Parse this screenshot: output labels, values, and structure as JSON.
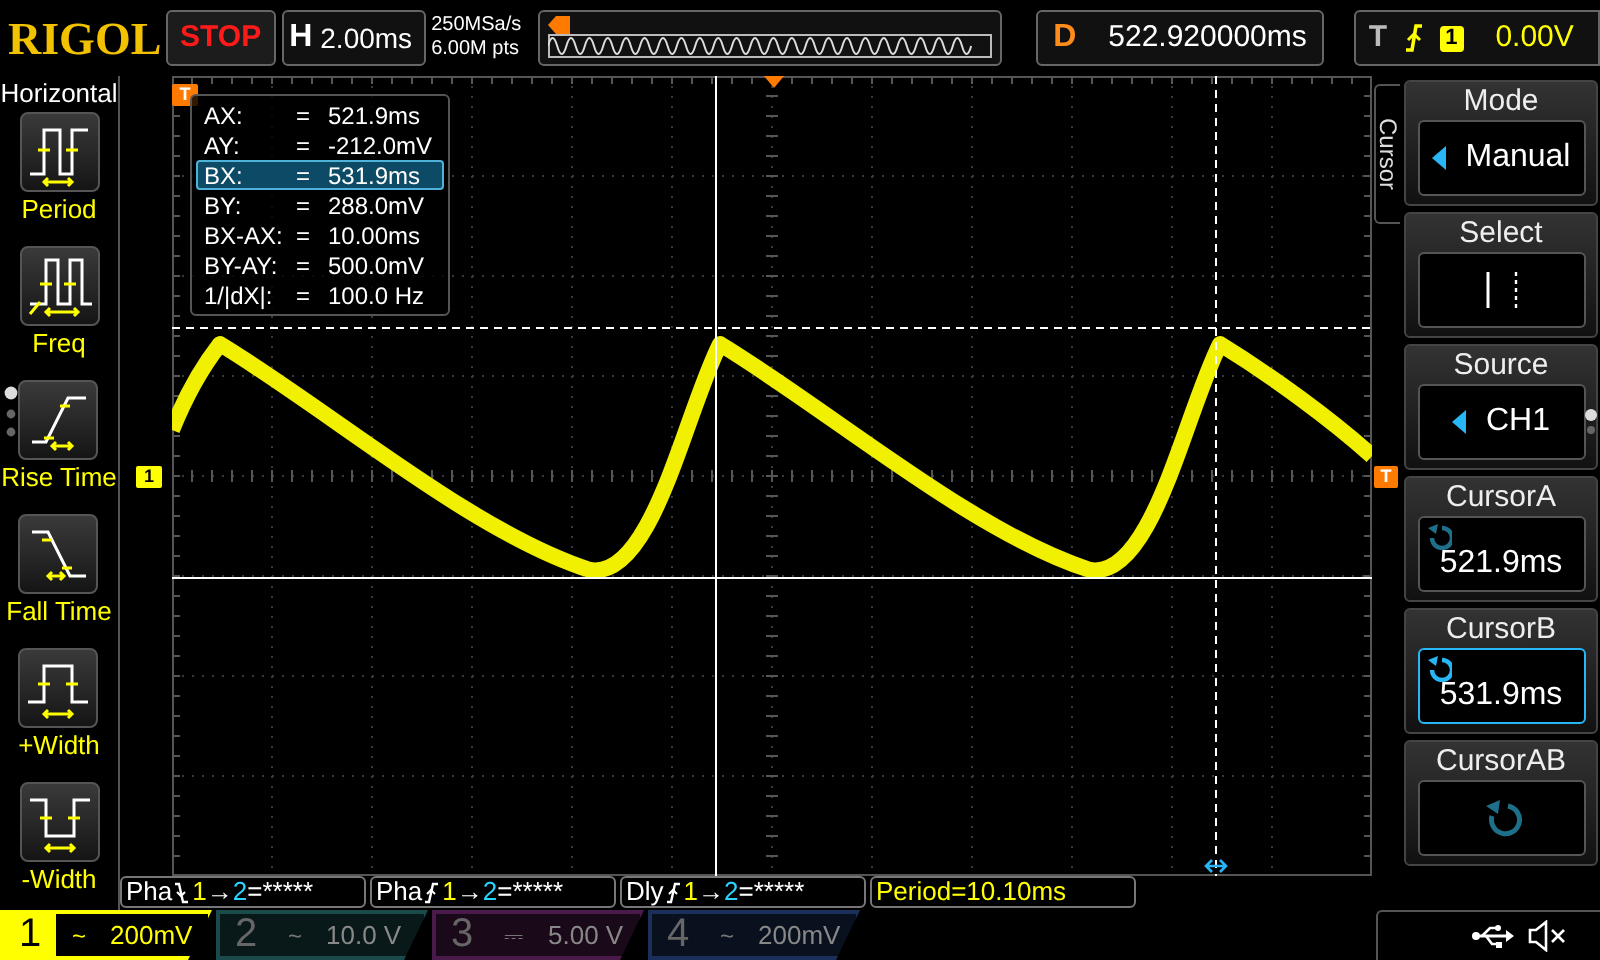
{
  "top_bar": {
    "logo": "RIGOL",
    "run_state": "STOP",
    "timebase": {
      "label": "H",
      "value": "2.00ms"
    },
    "sample_rate": "250MSa/s",
    "memory_depth": "6.00M pts",
    "delay": {
      "label": "D",
      "value": "522.920000ms"
    },
    "trigger": {
      "label": "T",
      "source": "1",
      "level": "0.00V"
    }
  },
  "left_menu": {
    "title": "Horizontal",
    "items": [
      {
        "label": "Period",
        "kind": "period"
      },
      {
        "label": "Freq",
        "kind": "freq"
      },
      {
        "label": "Rise Time",
        "kind": "rise"
      },
      {
        "label": "Fall Time",
        "kind": "fall"
      },
      {
        "label": "+Width",
        "kind": "pos_width"
      },
      {
        "label": "-Width",
        "kind": "neg_width"
      }
    ]
  },
  "markers": {
    "trigger_position": "T",
    "channel": "1",
    "trigger_level": "T"
  },
  "cursor_readout": [
    {
      "label": "AX:",
      "eq": "=",
      "value": "521.9ms",
      "selected": false
    },
    {
      "label": "AY:",
      "eq": "=",
      "value": "-212.0mV",
      "selected": false
    },
    {
      "label": "BX:",
      "eq": "=",
      "value": "531.9ms",
      "selected": true
    },
    {
      "label": "BY:",
      "eq": "=",
      "value": "288.0mV",
      "selected": false
    },
    {
      "label": "BX-AX:",
      "eq": "=",
      "value": "10.00ms",
      "selected": false
    },
    {
      "label": "BY-AY:",
      "eq": "=",
      "value": "500.0mV",
      "selected": false
    },
    {
      "label": "1/|dX|:",
      "eq": "=",
      "value": "100.0 Hz",
      "selected": false
    }
  ],
  "side_tab": "Cursor",
  "right_menu": [
    {
      "title": "Mode",
      "kind": "option",
      "value": "Manual"
    },
    {
      "title": "Select",
      "kind": "select"
    },
    {
      "title": "Source",
      "kind": "option",
      "value": "CH1"
    },
    {
      "title": "CursorA",
      "kind": "knob",
      "value": "521.9ms",
      "selected": false
    },
    {
      "title": "CursorB",
      "kind": "knob",
      "value": "531.9ms",
      "selected": true
    },
    {
      "title": "CursorAB",
      "kind": "knob",
      "selected": false
    }
  ],
  "measurements": [
    {
      "kind": "relation",
      "label": "Pha",
      "rising_edge": false,
      "from": "1",
      "arrow": "→",
      "to": "2",
      "value": "=*****"
    },
    {
      "kind": "relation",
      "label": "Pha",
      "rising_edge": true,
      "from": "1",
      "arrow": "→",
      "to": "2",
      "value": "=*****"
    },
    {
      "kind": "relation",
      "label": "Dly",
      "rising_edge": true,
      "from": "1",
      "arrow": "→",
      "to": "2",
      "value": "=*****"
    },
    {
      "kind": "text",
      "text": "Period=10.10ms"
    }
  ],
  "channels": [
    {
      "number": "1",
      "coupling": "~",
      "scale": "200mV",
      "active": true,
      "color": "#ffff00"
    },
    {
      "number": "2",
      "coupling": "~",
      "scale": "10.0 V",
      "active": false,
      "color": "#1a4a4a"
    },
    {
      "number": "3",
      "coupling": "⎓",
      "scale": "5.00 V",
      "active": false,
      "color": "#4a1a4a"
    },
    {
      "number": "4",
      "coupling": "~",
      "scale": "200mV",
      "active": false,
      "color": "#1a305a"
    }
  ]
}
